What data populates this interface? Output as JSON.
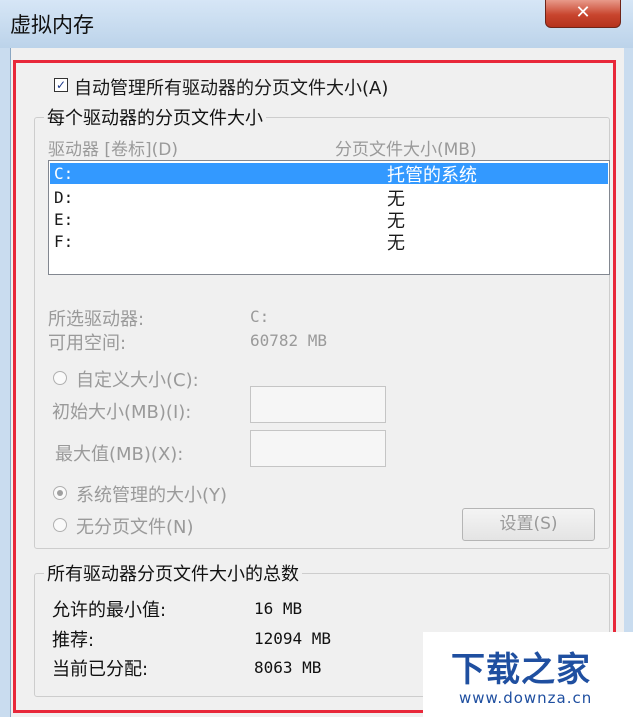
{
  "window": {
    "title": "虚拟内存",
    "close_glyph": "✕"
  },
  "auto_manage": {
    "label": "自动管理所有驱动器的分页文件大小(A)",
    "checked": true
  },
  "per_drive_group": {
    "legend": "每个驱动器的分页文件大小",
    "col_drive": "驱动器 [卷标](D)",
    "col_size": "分页文件大小(MB)",
    "rows": [
      {
        "drive": "C:",
        "size": "托管的系统",
        "selected": true
      },
      {
        "drive": "D:",
        "size": "无",
        "selected": false
      },
      {
        "drive": "E:",
        "size": "无",
        "selected": false
      },
      {
        "drive": "F:",
        "size": "无",
        "selected": false
      }
    ],
    "selected_drive_label": "所选驱动器:",
    "selected_drive_value": "C:",
    "free_space_label": "可用空间:",
    "free_space_value": "60782 MB",
    "custom_size_label": "自定义大小(C):",
    "initial_size_label": "初始大小(MB)(I):",
    "max_size_label": "最大值(MB)(X):",
    "system_managed_label": "系统管理的大小(Y)",
    "no_paging_label": "无分页文件(N)",
    "set_button": "设置(S)",
    "radio_selected": "system_managed"
  },
  "totals_group": {
    "legend": "所有驱动器分页文件大小的总数",
    "min_label": "允许的最小值:",
    "min_value": "16 MB",
    "recommended_label": "推荐:",
    "recommended_value": "12094 MB",
    "allocated_label": "当前已分配:",
    "allocated_value": "8063 MB"
  },
  "watermark": {
    "main": "下载之家",
    "sub": "www.downza.cn"
  },
  "colors": {
    "highlight": "#3399ff",
    "red_frame": "#e8283a",
    "watermark": "#1f4fa0"
  }
}
